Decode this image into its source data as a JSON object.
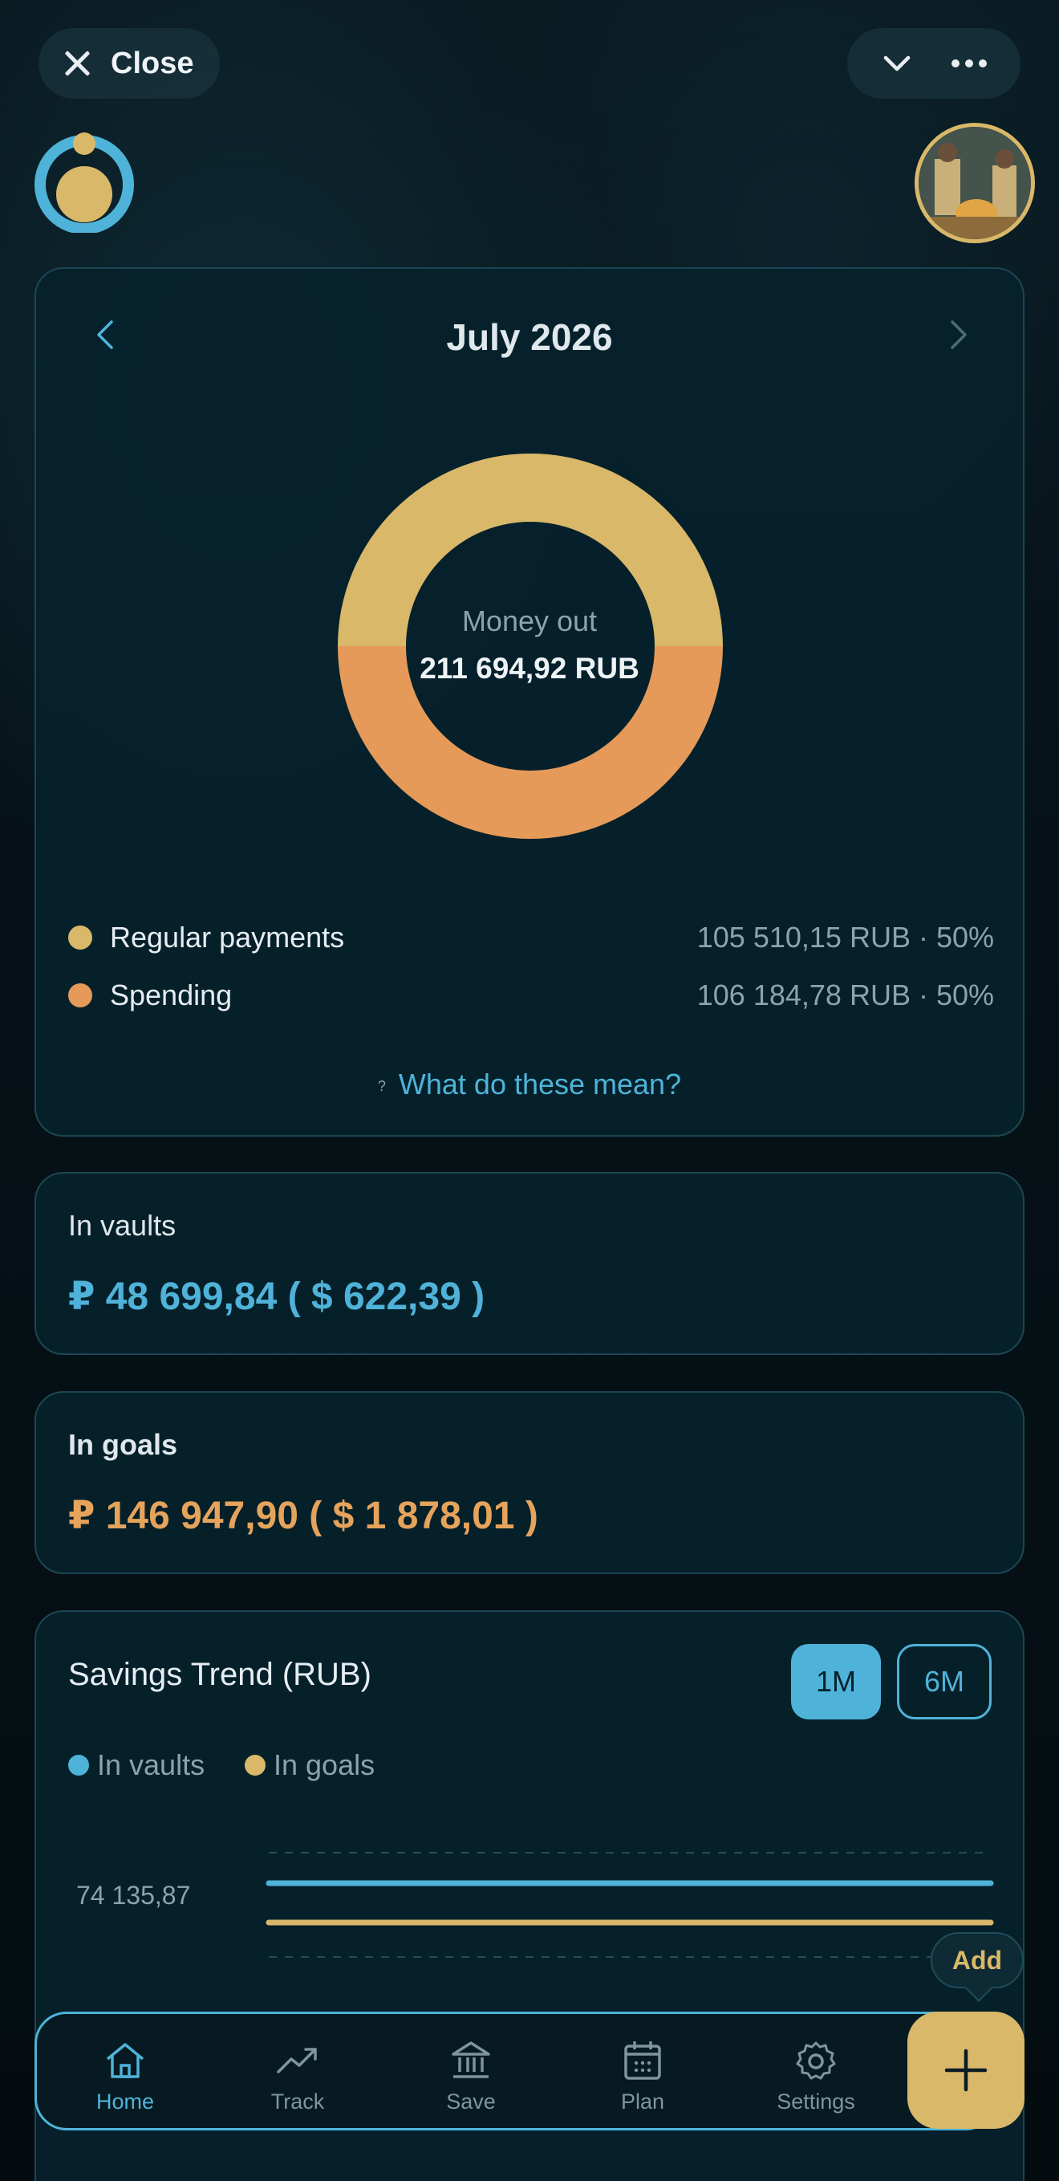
{
  "topbar": {
    "close_label": "Close",
    "chevron_icon": "chevron-down-icon",
    "more_icon": "more-icon"
  },
  "month_card": {
    "title": "July 2026",
    "donut": {
      "center_label": "Money out",
      "center_value": "211 694,92 RUB"
    },
    "legend": [
      {
        "name": "Regular payments",
        "value": "105 510,15 RUB · 50%",
        "color": "#d9b86a"
      },
      {
        "name": "Spending",
        "value": "106 184,78 RUB · 50%",
        "color": "#e59a59"
      }
    ],
    "help_mark": "?",
    "help_link": "What do these mean?"
  },
  "vaults": {
    "label": "In vaults",
    "amount": "₽ 48 699,84 ( $ 622,39 )"
  },
  "goals": {
    "label": "In goals",
    "amount": "₽ 146 947,90 ( $ 1 878,01 )"
  },
  "trend": {
    "title": "Savings Trend (RUB)",
    "range_1m": "1M",
    "range_6m": "6M",
    "legend_vaults": "In vaults",
    "legend_goals": "In goals",
    "y_tick": "74 135,87"
  },
  "chart_data": {
    "type": "line",
    "title": "Savings Trend (RUB)",
    "y_tick_labels": [
      "74 135,87"
    ],
    "series": [
      {
        "name": "In vaults",
        "color": "#4fb3d9",
        "values": [
          48699.84,
          48699.84
        ]
      },
      {
        "name": "In goals",
        "color": "#d9b86a",
        "values": [
          146947.9,
          146947.9
        ]
      }
    ]
  },
  "add_tooltip": "Add",
  "bottom_nav": [
    {
      "label": "Home",
      "icon": "home-icon",
      "active": true
    },
    {
      "label": "Track",
      "icon": "trending-up-icon",
      "active": false
    },
    {
      "label": "Save",
      "icon": "bank-icon",
      "active": false
    },
    {
      "label": "Plan",
      "icon": "calendar-icon",
      "active": false
    },
    {
      "label": "Settings",
      "icon": "settings-icon",
      "active": false
    }
  ],
  "colors": {
    "accent_blue": "#4fb3d9",
    "accent_gold": "#d9b86a",
    "accent_orange": "#e59a59"
  }
}
